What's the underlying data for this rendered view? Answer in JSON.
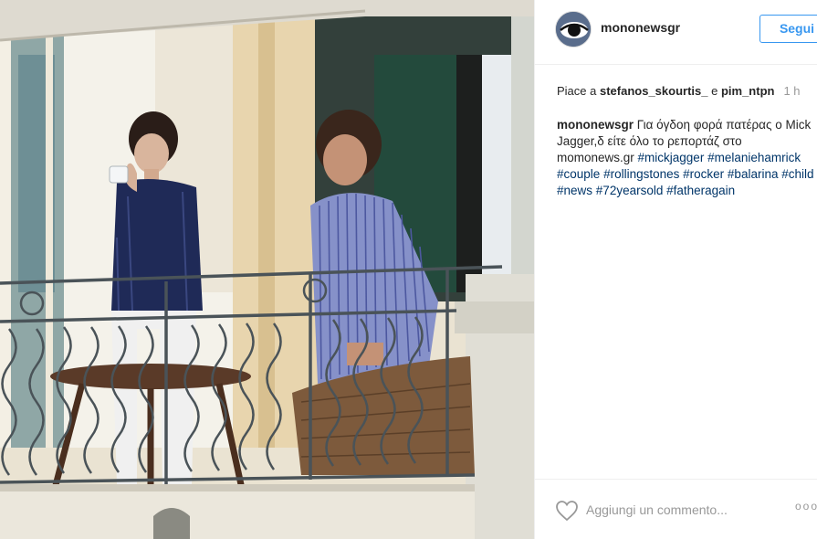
{
  "post": {
    "username": "mononewsgr",
    "follow_label": "Segui",
    "likes_prefix": "Piace a ",
    "liker_1": "stefanos_skourtis_",
    "likes_conj": " e ",
    "liker_2": "pim_ntpn",
    "time_ago": "1 h",
    "caption_author": "mononewsgr",
    "caption_text": " Για όγδοη φορά πατέρας ο Mick Jagger,δ είτε όλο το ρεπορτάζ στο momonews.gr ",
    "hashtags": [
      "#mickjagger",
      "#melaniehamrick",
      "#couple",
      "#rollingstones",
      "#rocker",
      "#balarina",
      "#child",
      "#news",
      "#72yearsold",
      "#fatheragain"
    ],
    "comment_placeholder": "Aggiungi un commento...",
    "more_label": "ooo"
  },
  "icons": {
    "avatar": "eye-logo",
    "like": "heart-outline-icon",
    "more": "ellipsis-icon"
  },
  "colors": {
    "link_blue": "#3897f0",
    "hashtag": "#003569",
    "muted": "#999999",
    "border": "#efefef"
  }
}
